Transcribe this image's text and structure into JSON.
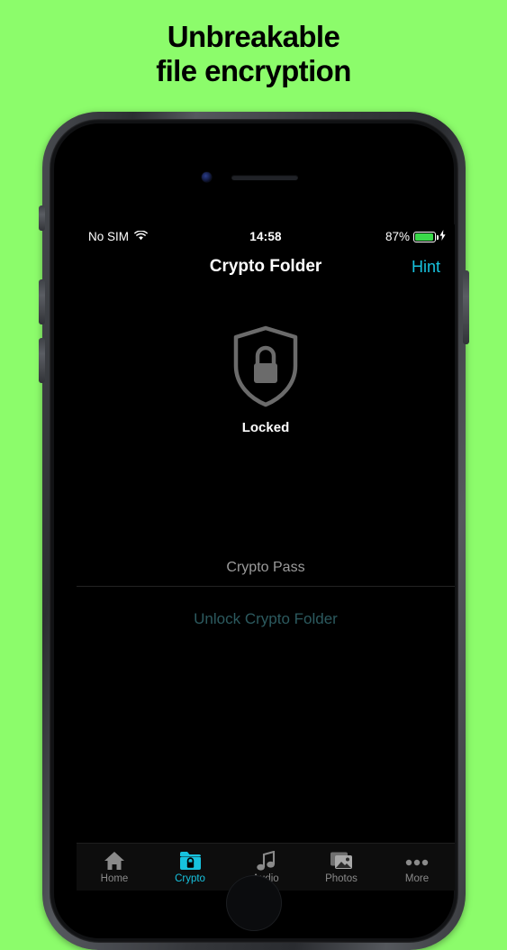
{
  "headline": {
    "line1": "Unbreakable",
    "line2": "file encryption"
  },
  "colors": {
    "background": "#8CFC6B",
    "accent": "#17c2de",
    "battery_green": "#3ad94a",
    "disabled_teal": "#2c5a5f",
    "shield_gray": "#6b6b6b"
  },
  "status_bar": {
    "carrier": "No SIM",
    "wifi_icon": "wifi-icon",
    "time": "14:58",
    "battery_percent": "87%",
    "battery_level": 87,
    "charging_icon": "lightning-bolt-icon"
  },
  "nav_bar": {
    "title": "Crypto Folder",
    "action_label": "Hint"
  },
  "lock_state": {
    "icon": "shield-lock-icon",
    "label": "Locked"
  },
  "password_field": {
    "placeholder": "Crypto Pass",
    "value": ""
  },
  "unlock_button": {
    "label": "Unlock Crypto Folder",
    "enabled": false
  },
  "tab_bar": {
    "items": [
      {
        "label": "Home",
        "icon": "home-icon",
        "active": false
      },
      {
        "label": "Crypto",
        "icon": "folder-lock-icon",
        "active": true
      },
      {
        "label": "Audio",
        "icon": "music-note-icon",
        "active": false
      },
      {
        "label": "Photos",
        "icon": "photo-stack-icon",
        "active": false
      },
      {
        "label": "More",
        "icon": "ellipsis-icon",
        "active": false
      }
    ]
  }
}
